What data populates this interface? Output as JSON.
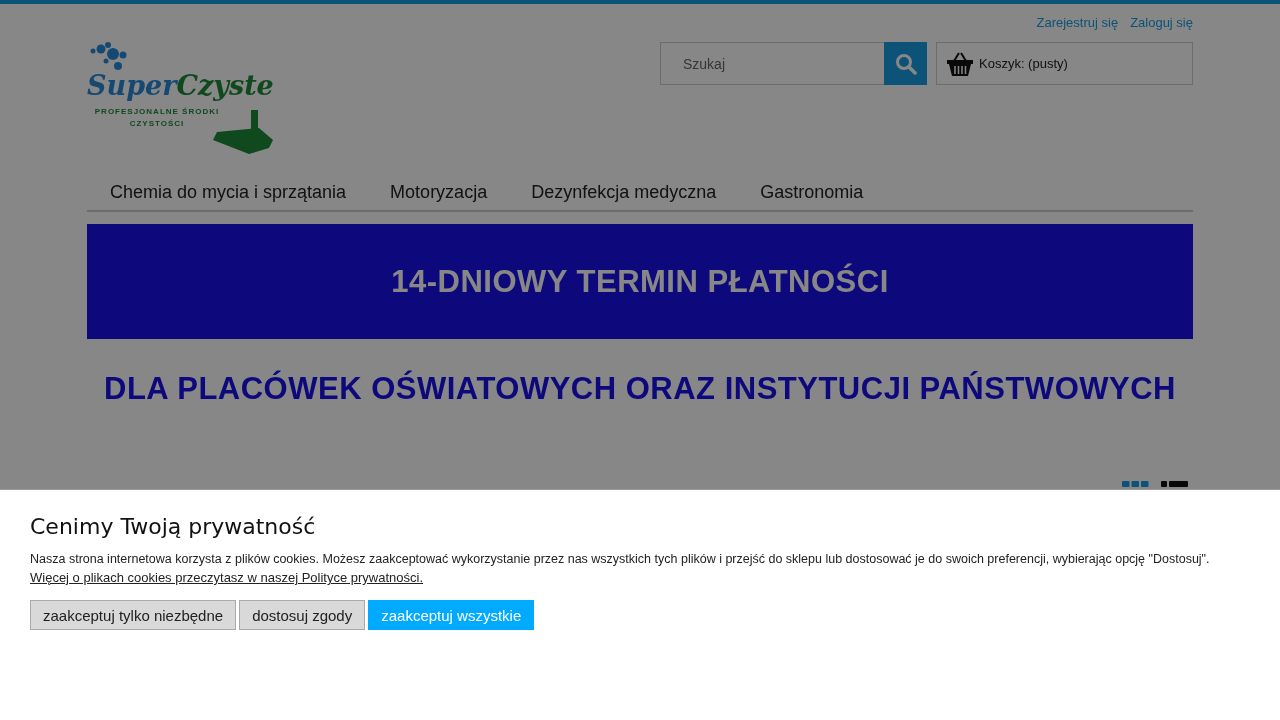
{
  "top_links": [
    {
      "label": "Zarejestruj się"
    },
    {
      "label": "Zaloguj się"
    }
  ],
  "logo": {
    "brand_first": "Super",
    "brand_second": "Czyste",
    "tagline": [
      "PROFESJONALNE ŚRODKI",
      "CZYSTOŚCI"
    ]
  },
  "search": {
    "placeholder": "Szukaj"
  },
  "cart": {
    "label": "Koszyk: (pusty)"
  },
  "nav": [
    {
      "label": "Chemia do mycia i sprzątania"
    },
    {
      "label": "Motoryzacja"
    },
    {
      "label": "Dezynfekcja medyczna"
    },
    {
      "label": "Gastronomia"
    }
  ],
  "banner": {
    "headline": "14-DNIOWY TERMIN PŁATNOŚCI",
    "subline": "DLA PLACÓWEK OŚWIATOWYCH ORAZ INSTYTUCJI PAŃSTWOWYCH"
  },
  "view_toggle": [
    {
      "kind": "grid",
      "selected": true
    },
    {
      "kind": "list",
      "selected": false
    }
  ],
  "cookie_notice": {
    "title": "Cenimy Twoją prywatność",
    "text": "Nasza strona internetowa korzysta z plików cookies. Możesz zaakceptować wykorzystanie przez nas wszystkich tych plików i przejść do sklepu lub dostosować je do swoich preferencji, wybierając opcję \"Dostosuj\".",
    "link": "Więcej o plikach cookies przeczytasz w naszej Polityce prywatności.",
    "buttons": [
      {
        "label": "zaakceptuj tylko niezbędne",
        "primary": false
      },
      {
        "label": "dostosuj zgody",
        "primary": false
      },
      {
        "label": "zaakceptuj wszystkie",
        "primary": true
      }
    ]
  }
}
